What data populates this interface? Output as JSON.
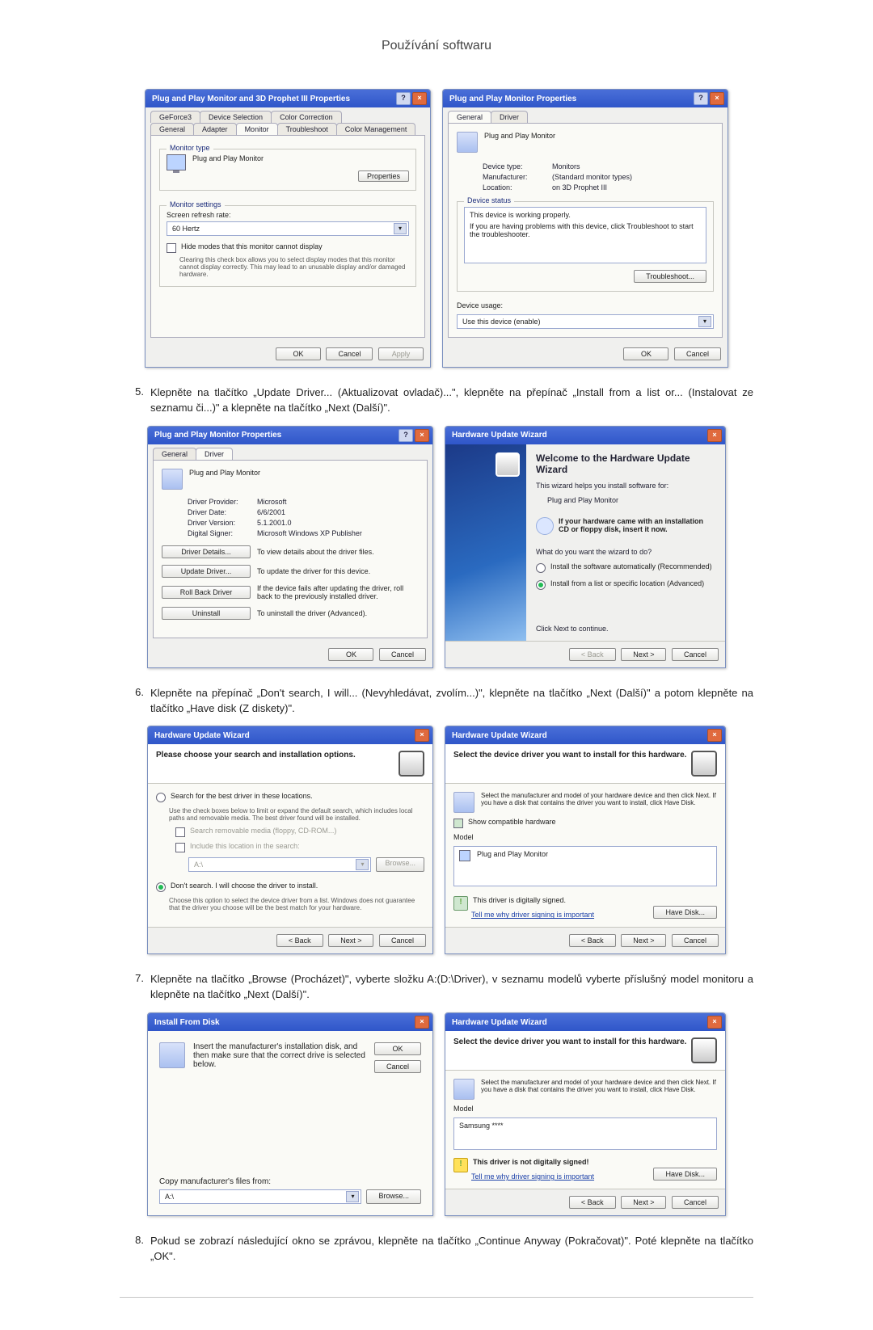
{
  "page_title": "Používání softwaru",
  "steps": {
    "s5": {
      "num": "5.",
      "text": "Klepněte na tlačítko „Update Driver... (Aktualizovat ovladač)...\", klepněte na přepínač „Install from a list or... (Instalovat ze seznamu či...)\" a klepněte na tlačítko „Next (Další)\"."
    },
    "s6": {
      "num": "6.",
      "text": "Klepněte na přepínač „Don't search, I will... (Nevyhledávat, zvolím...)\", klepněte na tlačítko „Next (Další)\" a potom klepněte na tlačítko „Have disk (Z diskety)\"."
    },
    "s7": {
      "num": "7.",
      "text": "Klepněte na tlačítko „Browse (Procházet)\", vyberte složku A:(D:\\Driver), v seznamu modelů vyberte příslušný model monitoru a klepněte na tlačítko „Next (Další)\"."
    },
    "s8": {
      "num": "8.",
      "text": "Pokud se zobrazí následující okno se zprávou, klepněte na tlačítko „Continue Anyway (Pokračovat)\". Poté klepněte na tlačítko „OK\"."
    }
  },
  "common_buttons": {
    "ok": "OK",
    "cancel": "Cancel",
    "apply": "Apply",
    "back": "< Back",
    "next": "Next >",
    "browse": "Browse...",
    "have_disk": "Have Disk..."
  },
  "dlgA1": {
    "title": "Plug and Play Monitor and 3D Prophet III Properties",
    "tabs": [
      "GeForce3",
      "Device Selection",
      "Color Correction",
      "General",
      "Adapter",
      "Monitor",
      "Troubleshoot",
      "Color Management"
    ],
    "monitor_type_legend": "Monitor type",
    "monitor_type_value": "Plug and Play Monitor",
    "properties_btn": "Properties",
    "monitor_settings_legend": "Monitor settings",
    "refresh_label": "Screen refresh rate:",
    "refresh_value": "60 Hertz",
    "hide_modes_check": "Hide modes that this monitor cannot display",
    "hide_modes_desc": "Clearing this check box allows you to select display modes that this monitor cannot display correctly. This may lead to an unusable display and/or damaged hardware."
  },
  "dlgA2": {
    "title": "Plug and Play Monitor Properties",
    "tabs": [
      "General",
      "Driver"
    ],
    "header_text": "Plug and Play Monitor",
    "kv": {
      "device_type_k": "Device type:",
      "device_type_v": "Monitors",
      "manufacturer_k": "Manufacturer:",
      "manufacturer_v": "(Standard monitor types)",
      "location_k": "Location:",
      "location_v": "on 3D Prophet III"
    },
    "status_legend": "Device status",
    "status_line1": "This device is working properly.",
    "status_line2": "If you are having problems with this device, click Troubleshoot to start the troubleshooter.",
    "troubleshoot_btn": "Troubleshoot...",
    "usage_label": "Device usage:",
    "usage_value": "Use this device (enable)"
  },
  "dlgB1": {
    "title": "Plug and Play Monitor Properties",
    "tabs": [
      "General",
      "Driver"
    ],
    "header_text": "Plug and Play Monitor",
    "kv": {
      "provider_k": "Driver Provider:",
      "provider_v": "Microsoft",
      "date_k": "Driver Date:",
      "date_v": "6/6/2001",
      "version_k": "Driver Version:",
      "version_v": "5.1.2001.0",
      "signer_k": "Digital Signer:",
      "signer_v": "Microsoft Windows XP Publisher"
    },
    "btn_details": "Driver Details...",
    "btn_details_desc": "To view details about the driver files.",
    "btn_update": "Update Driver...",
    "btn_update_desc": "To update the driver for this device.",
    "btn_rollback": "Roll Back Driver",
    "btn_rollback_desc": "If the device fails after updating the driver, roll back to the previously installed driver.",
    "btn_uninstall": "Uninstall",
    "btn_uninstall_desc": "To uninstall the driver (Advanced)."
  },
  "dlgB2": {
    "title": "Hardware Update Wizard",
    "welcome_title": "Welcome to the Hardware Update Wizard",
    "welcome_sub1": "This wizard helps you install software for:",
    "welcome_sub2": "Plug and Play Monitor",
    "cd_hint": "If your hardware came with an installation CD or floppy disk, insert it now.",
    "q": "What do you want the wizard to do?",
    "opt_auto": "Install the software automatically (Recommended)",
    "opt_list": "Install from a list or specific location (Advanced)",
    "continue_hint": "Click Next to continue."
  },
  "dlgC1": {
    "title": "Hardware Update Wizard",
    "heading": "Please choose your search and installation options.",
    "opt_search": "Search for the best driver in these locations.",
    "opt_search_desc": "Use the check boxes below to limit or expand the default search, which includes local paths and removable media. The best driver found will be installed.",
    "chk_removable": "Search removable media (floppy, CD-ROM...)",
    "chk_include": "Include this location in the search:",
    "path_value": "A:\\",
    "opt_dont": "Don't search. I will choose the driver to install.",
    "opt_dont_desc": "Choose this option to select the device driver from a list. Windows does not guarantee that the driver you choose will be the best match for your hardware."
  },
  "dlgC2": {
    "title": "Hardware Update Wizard",
    "heading": "Select the device driver you want to install for this hardware.",
    "sub": "Select the manufacturer and model of your hardware device and then click Next. If you have a disk that contains the driver you want to install, click Have Disk.",
    "show_compat": "Show compatible hardware",
    "model_label": "Model",
    "model_item": "Plug and Play Monitor",
    "signed_text": "This driver is digitally signed.",
    "signed_link": "Tell me why driver signing is important"
  },
  "dlgD1": {
    "title": "Install From Disk",
    "msg": "Insert the manufacturer's installation disk, and then make sure that the correct drive is selected below.",
    "copy_label": "Copy manufacturer's files from:",
    "path_value": "A:\\"
  },
  "dlgD2": {
    "title": "Hardware Update Wizard",
    "heading": "Select the device driver you want to install for this hardware.",
    "sub": "Select the manufacturer and model of your hardware device and then click Next. If you have a disk that contains the driver you want to install, click Have Disk.",
    "model_label": "Model",
    "model_item": "Samsung ****",
    "unsigned_text": "This driver is not digitally signed!",
    "signed_link": "Tell me why driver signing is important"
  }
}
